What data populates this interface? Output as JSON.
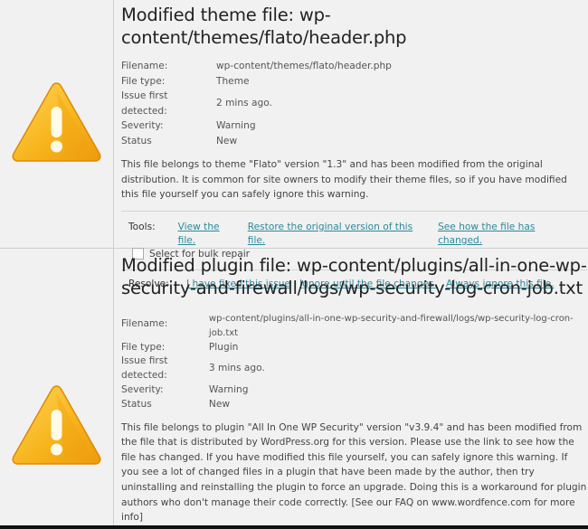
{
  "issues": [
    {
      "title": "Modified theme file: wp-content/themes/flato/header.php",
      "icon": "warning-triangle-icon",
      "meta": {
        "filename_label": "Filename:",
        "filename": "wp-content/themes/flato/header.php",
        "filetype_label": "File type:",
        "filetype": "Theme",
        "detected_label": "Issue first detected:",
        "detected": "2 mins ago.",
        "severity_label": "Severity:",
        "severity": "Warning",
        "status_label": "Status",
        "status": "New"
      },
      "description": "This file belongs to theme \"Flato\" version \"1.3\" and has been modified from the original distribution. It is common for site owners to modify their theme files, so if you have modified this file yourself you can safely ignore this warning.",
      "tools_label": "Tools:",
      "tools": [
        "View the file.",
        "Restore the original version of this file.",
        "See how the file has changed."
      ],
      "bulk_label": "Select for bulk repair",
      "bulk_checked": false,
      "resolve_label": "Resolve:",
      "resolve": [
        "I have fixed this issue",
        "Ignore until the file changes.",
        "Always ignore this file."
      ]
    },
    {
      "title": "Modified plugin file: wp-content/plugins/all-in-one-wp-security-and-firewall/logs/wp-security-log-cron-job.txt",
      "icon": "warning-triangle-icon",
      "meta": {
        "filename_label": "Filename:",
        "filename": "wp-content/plugins/all-in-one-wp-security-and-firewall/logs/wp-security-log-cron-job.txt",
        "filetype_label": "File type:",
        "filetype": "Plugin",
        "detected_label": "Issue first detected:",
        "detected": "3 mins ago.",
        "severity_label": "Severity:",
        "severity": "Warning",
        "status_label": "Status",
        "status": "New"
      },
      "description": "This file belongs to plugin \"All In One WP Security\" version \"v3.9.4\" and has been modified from the file that is distributed by WordPress.org for this version. Please use the link to see how the file has changed. If you have modified this file yourself, you can safely ignore this warning. If you see a lot of changed files in a plugin that have been made by the author, then try uninstalling and reinstalling the plugin to force an upgrade. Doing this is a workaround for plugin authors who don't manage their code correctly. [See our FAQ on www.wordfence.com for more info]"
    }
  ],
  "colors": {
    "link": "#2a8a9a",
    "warning_fill": "#f6b21c",
    "background": "#f1f1f1"
  }
}
